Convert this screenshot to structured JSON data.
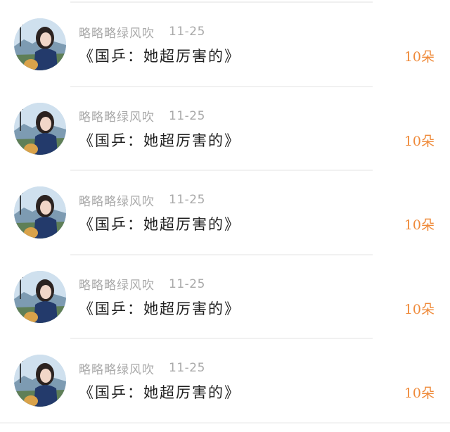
{
  "rows": [
    {
      "username": "略略略绿风吹",
      "date": "11-25",
      "title": "《国乒：她超厉害的》",
      "count": "10朵"
    },
    {
      "username": "略略略绿风吹",
      "date": "11-25",
      "title": "《国乒：她超厉害的》",
      "count": "10朵"
    },
    {
      "username": "略略略绿风吹",
      "date": "11-25",
      "title": "《国乒：她超厉害的》",
      "count": "10朵"
    },
    {
      "username": "略略略绿风吹",
      "date": "11-25",
      "title": "《国乒：她超厉害的》",
      "count": "10朵"
    },
    {
      "username": "略略略绿风吹",
      "date": "11-25",
      "title": "《国乒：她超厉害的》",
      "count": "10朵"
    }
  ],
  "colors": {
    "count": "#ef8a3a",
    "meta": "#a9a9a9",
    "title": "#1f1f1f"
  }
}
